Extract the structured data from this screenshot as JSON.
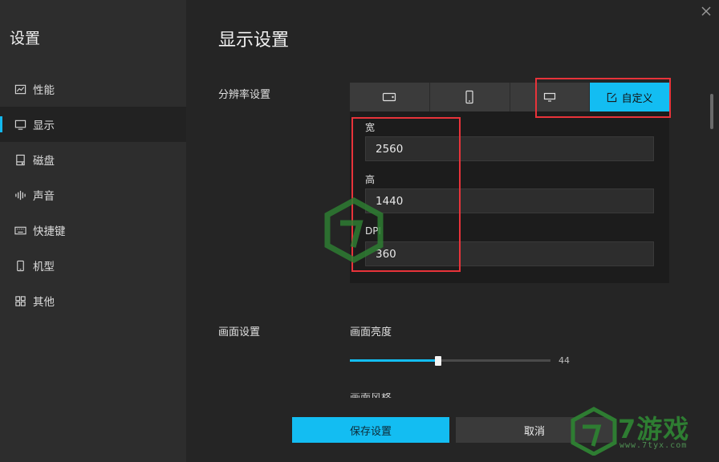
{
  "sidebar": {
    "title": "设置",
    "items": [
      {
        "label": "性能",
        "icon": "chart-line-icon",
        "active": false
      },
      {
        "label": "显示",
        "icon": "monitor-icon",
        "active": true
      },
      {
        "label": "磁盘",
        "icon": "disk-icon",
        "active": false
      },
      {
        "label": "声音",
        "icon": "sound-wave-icon",
        "active": false
      },
      {
        "label": "快捷键",
        "icon": "keyboard-icon",
        "active": false
      },
      {
        "label": "机型",
        "icon": "phone-icon",
        "active": false
      },
      {
        "label": "其他",
        "icon": "grid-icon",
        "active": false
      }
    ]
  },
  "main": {
    "title": "显示设置",
    "resolution": {
      "label": "分辨率设置",
      "tabs": [
        {
          "icon": "tablet-landscape-icon",
          "label": ""
        },
        {
          "icon": "phone-portrait-icon",
          "label": ""
        },
        {
          "icon": "monitor-icon",
          "label": ""
        },
        {
          "icon": "edit-icon",
          "label": "自定义",
          "active": true
        }
      ],
      "custom": {
        "width_label": "宽",
        "width_value": "2560",
        "height_label": "高",
        "height_value": "1440",
        "dpi_label": "DPI",
        "dpi_value": "360"
      }
    },
    "screen": {
      "label": "画面设置",
      "brightness_label": "画面亮度",
      "brightness_value": "44",
      "brightness_level": 0.44,
      "next_label_cut": "画面风格"
    },
    "buttons": {
      "save": "保存设置",
      "cancel": "取消"
    }
  },
  "watermark": {
    "brand_text": "7游戏",
    "url": "www.7tyx.com"
  },
  "colors": {
    "accent": "#13bdf2",
    "sidebar_bg": "#2d2d2d",
    "main_bg": "#252525",
    "highlight_box": "#e8333a",
    "watermark_green": "#2e7d32"
  }
}
